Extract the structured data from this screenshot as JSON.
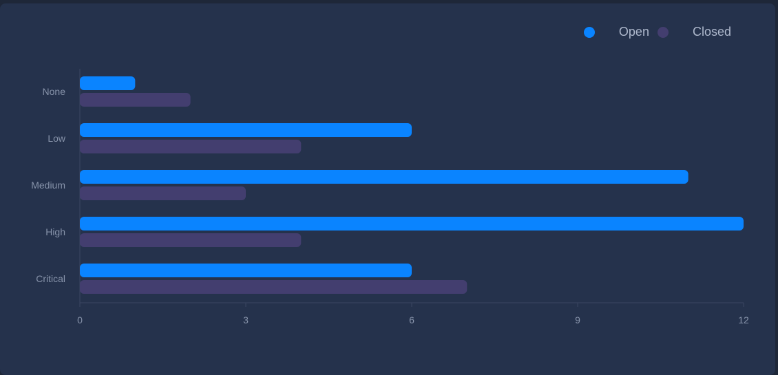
{
  "colors": {
    "open": "#0a84ff",
    "closed": "#433e6f",
    "axis": "#3a4762",
    "background": "#25324c"
  },
  "legend": {
    "items": [
      {
        "label": "Open",
        "color": "#0a84ff"
      },
      {
        "label": "Closed",
        "color": "#433e6f"
      }
    ],
    "placement": "top-right"
  },
  "chart_data": {
    "type": "bar",
    "orientation": "horizontal",
    "categories": [
      "None",
      "Low",
      "Medium",
      "High",
      "Critical"
    ],
    "series": [
      {
        "name": "Open",
        "values": [
          1,
          6,
          11,
          12,
          6
        ]
      },
      {
        "name": "Closed",
        "values": [
          2,
          4,
          3,
          4,
          7
        ]
      }
    ],
    "xticks": [
      0,
      3,
      6,
      9,
      12
    ],
    "xlim": [
      0,
      12
    ],
    "grid": false
  }
}
